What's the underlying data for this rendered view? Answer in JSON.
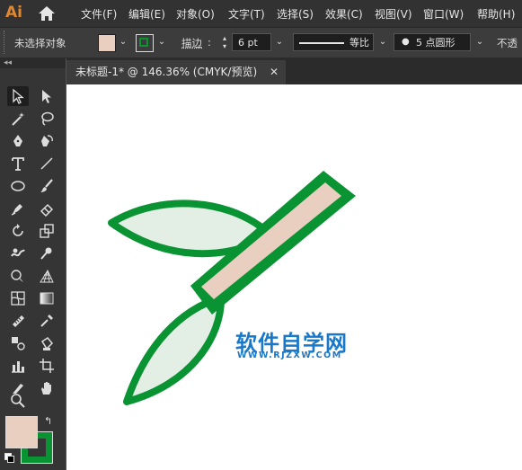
{
  "app": {
    "logo": "Ai"
  },
  "menu": [
    "文件(F)",
    "编辑(E)",
    "对象(O)",
    "文字(T)",
    "选择(S)",
    "效果(C)",
    "视图(V)",
    "窗口(W)",
    "帮助(H)"
  ],
  "control_bar": {
    "selection_status": "未选择对象",
    "stroke_label": "描边",
    "stroke_weight": "6 pt",
    "profile_label": "等比",
    "brush_label": "5 点圆形",
    "opacity_label": "不透"
  },
  "panel": {
    "collapse_glyph": "◂◂"
  },
  "document": {
    "tab_title": "未标题-1* @ 146.36% (CMYK/预览)",
    "close_glyph": "✕"
  },
  "watermark": {
    "title": "软件自学网",
    "url": "WWW.RJZXW.COM"
  },
  "colors": {
    "fill": "#e8cfc0",
    "stroke": "#0a9332",
    "leaf_fill": "#e3efe5",
    "watermark": "#1a78c8",
    "accent": "#e0872f"
  }
}
